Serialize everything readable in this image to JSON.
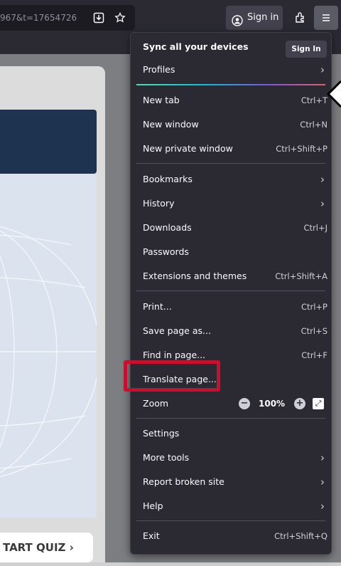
{
  "toolbar": {
    "url_text": "967&t=17654726",
    "icons": [
      "save-to-pocket-icon",
      "bookmark-star-icon",
      "account-icon",
      "extensions-icon",
      "hamburger-menu-icon"
    ],
    "signin_label": "Sign in"
  },
  "page": {
    "quiz_label": "TART QUIZ ›"
  },
  "menu": {
    "sync_title": "Sync all your devices",
    "sync_button": "Sign In",
    "items": [
      {
        "label": "Profiles",
        "shortcut": "",
        "submenu": true
      },
      {
        "label": "New tab",
        "shortcut": "Ctrl+T"
      },
      {
        "label": "New window",
        "shortcut": "Ctrl+N"
      },
      {
        "label": "New private window",
        "shortcut": "Ctrl+Shift+P"
      },
      {
        "label": "Bookmarks",
        "submenu": true
      },
      {
        "label": "History",
        "submenu": true
      },
      {
        "label": "Downloads",
        "shortcut": "Ctrl+J"
      },
      {
        "label": "Passwords",
        "shortcut": ""
      },
      {
        "label": "Extensions and themes",
        "shortcut": "Ctrl+Shift+A"
      },
      {
        "label": "Print...",
        "shortcut": "Ctrl+P"
      },
      {
        "label": "Save page as...",
        "shortcut": "Ctrl+S"
      },
      {
        "label": "Find in page...",
        "shortcut": "Ctrl+F"
      },
      {
        "label": "Translate page...",
        "shortcut": ""
      },
      {
        "label": "Zoom",
        "zoom_value": "100%"
      },
      {
        "label": "Settings",
        "shortcut": ""
      },
      {
        "label": "More tools",
        "submenu": true
      },
      {
        "label": "Report broken site",
        "submenu": true
      },
      {
        "label": "Help",
        "submenu": true
      },
      {
        "label": "Exit",
        "shortcut": "Ctrl+Shift+Q"
      }
    ]
  },
  "colors": {
    "menu_bg": "#2b2a33",
    "highlight": "#c8102e",
    "page_dark": "#1e3350"
  }
}
